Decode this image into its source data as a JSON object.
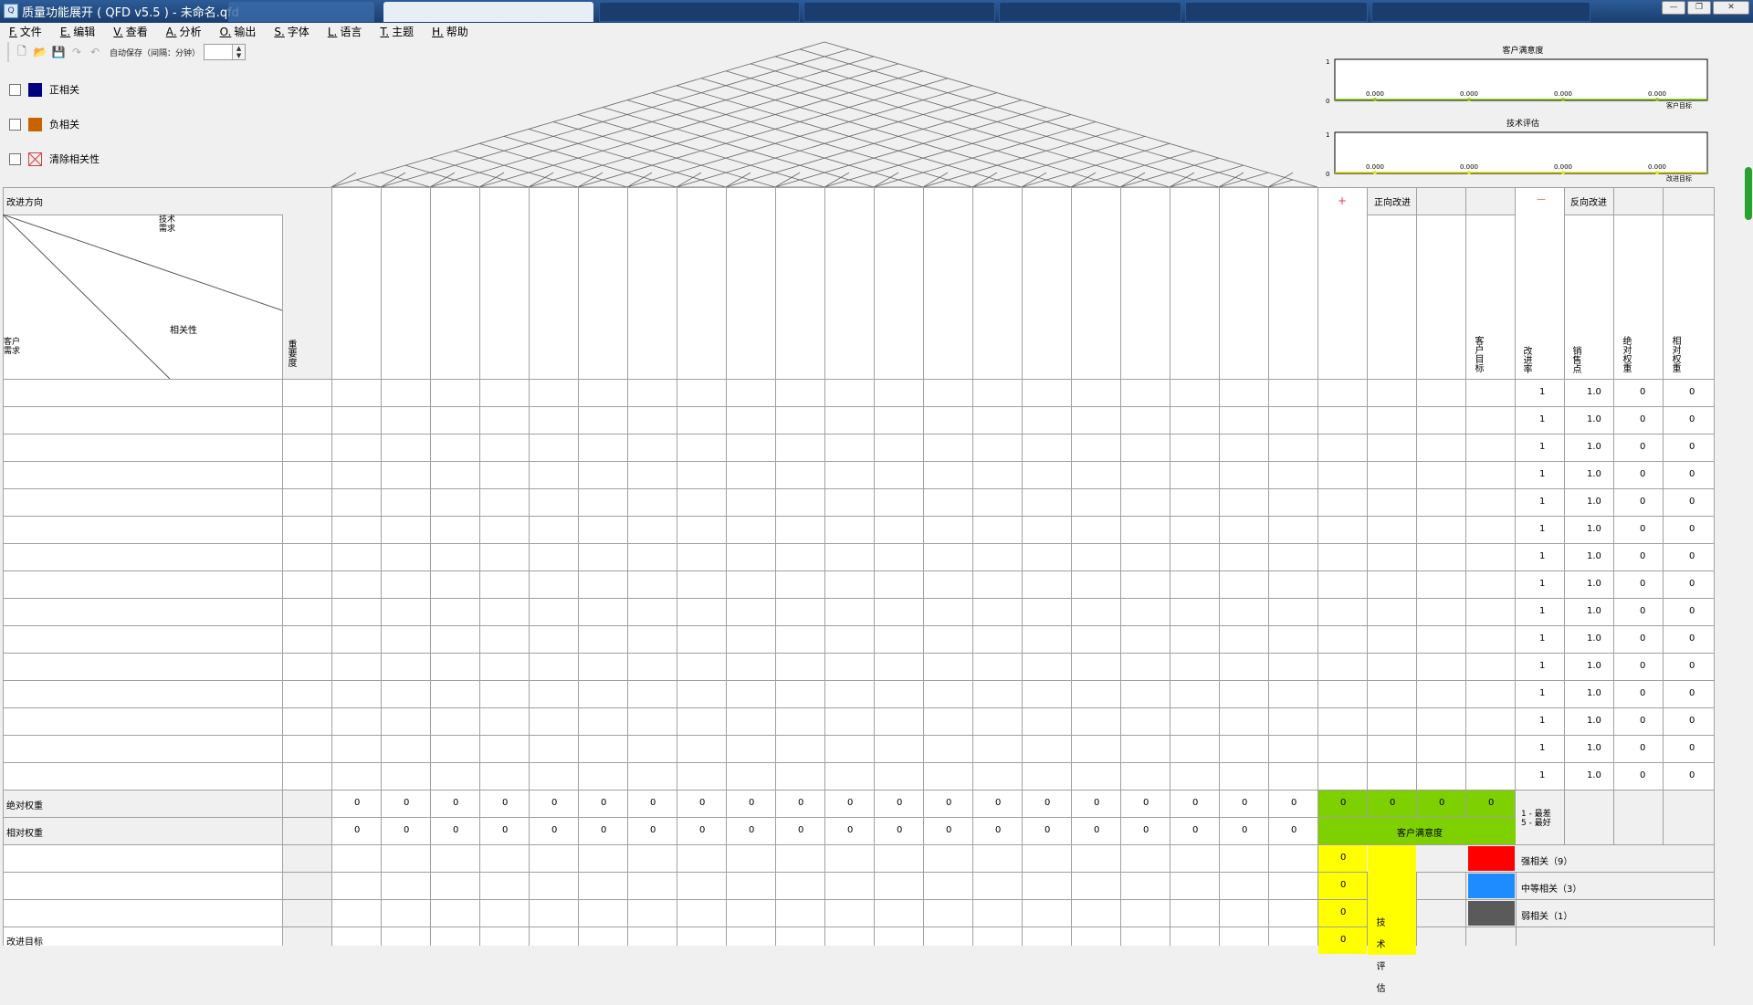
{
  "window": {
    "title": "质量功能展开 ( QFD  v5.5 ) - 未命名.qfd",
    "app_icon_text": "Q",
    "tabs": [
      "",
      "...",
      "",
      "",
      "",
      "",
      "",
      ""
    ]
  },
  "menu": [
    {
      "key": "F.",
      "label": "文件"
    },
    {
      "key": "E.",
      "label": "编辑"
    },
    {
      "key": "V.",
      "label": "查看"
    },
    {
      "key": "A.",
      "label": "分析"
    },
    {
      "key": "O.",
      "label": "输出"
    },
    {
      "key": "S.",
      "label": "字体"
    },
    {
      "key": "L.",
      "label": "语言"
    },
    {
      "key": "T.",
      "label": "主题"
    },
    {
      "key": "H.",
      "label": "帮助"
    }
  ],
  "toolbar": {
    "autosave_label": "自动保存（间隔：分钟）",
    "autosave_value": ""
  },
  "legend": {
    "positive": {
      "label": "正相关",
      "color": "#00007f"
    },
    "negative": {
      "label": "负相关",
      "color": "#c86400"
    },
    "clear": {
      "label": "清除相关性"
    }
  },
  "mini_charts": [
    {
      "title": "客户满意度",
      "y_max": "1",
      "y_min": "0",
      "values": [
        "0.000",
        "0.000",
        "0.000",
        "0.000"
      ],
      "x_label": "客户目标",
      "line_color": "#7cc800"
    },
    {
      "title": "技术评估",
      "y_max": "1",
      "y_min": "0",
      "values": [
        "0.000",
        "0.000",
        "0.000",
        "0.000"
      ],
      "x_label": "改进目标",
      "line_color": "#e6e600"
    }
  ],
  "matrix": {
    "improve_direction": "改进方向",
    "tech_req": "技术\n需求",
    "correlation": "相关性",
    "cust_req": "客户\n需求",
    "importance": "重要度",
    "plus": "+",
    "pos_improve": "正向改进",
    "minus": "—",
    "neg_improve": "反向改进",
    "right_headers": [
      "客户目标",
      "改进率",
      "销售点",
      "绝对权重",
      "相对权重"
    ],
    "row_values": {
      "improve": "1",
      "sales": "1.0",
      "abs": "0",
      "rel": "0"
    },
    "row_count": 15,
    "abs_weight_label": "绝对权重",
    "rel_weight_label": "相对权重",
    "col_zero": "0",
    "green_values": [
      "0",
      "0",
      "0",
      "0"
    ],
    "satisfaction_label": "客户满意度",
    "scale_note_1": "1 - 最差",
    "scale_note_2": "5 - 最好",
    "yellow_values": [
      "0",
      "0",
      "0",
      "0"
    ],
    "tech_eval_label": "技术评估",
    "strong": {
      "label": "强相关（9）",
      "color": "#ff0000"
    },
    "medium": {
      "label": "中等相关（3）",
      "color": "#1e8cff"
    },
    "weak": {
      "label": "弱相关（1）",
      "color": "#5a5a5a"
    },
    "improve_target": "改进目标"
  }
}
